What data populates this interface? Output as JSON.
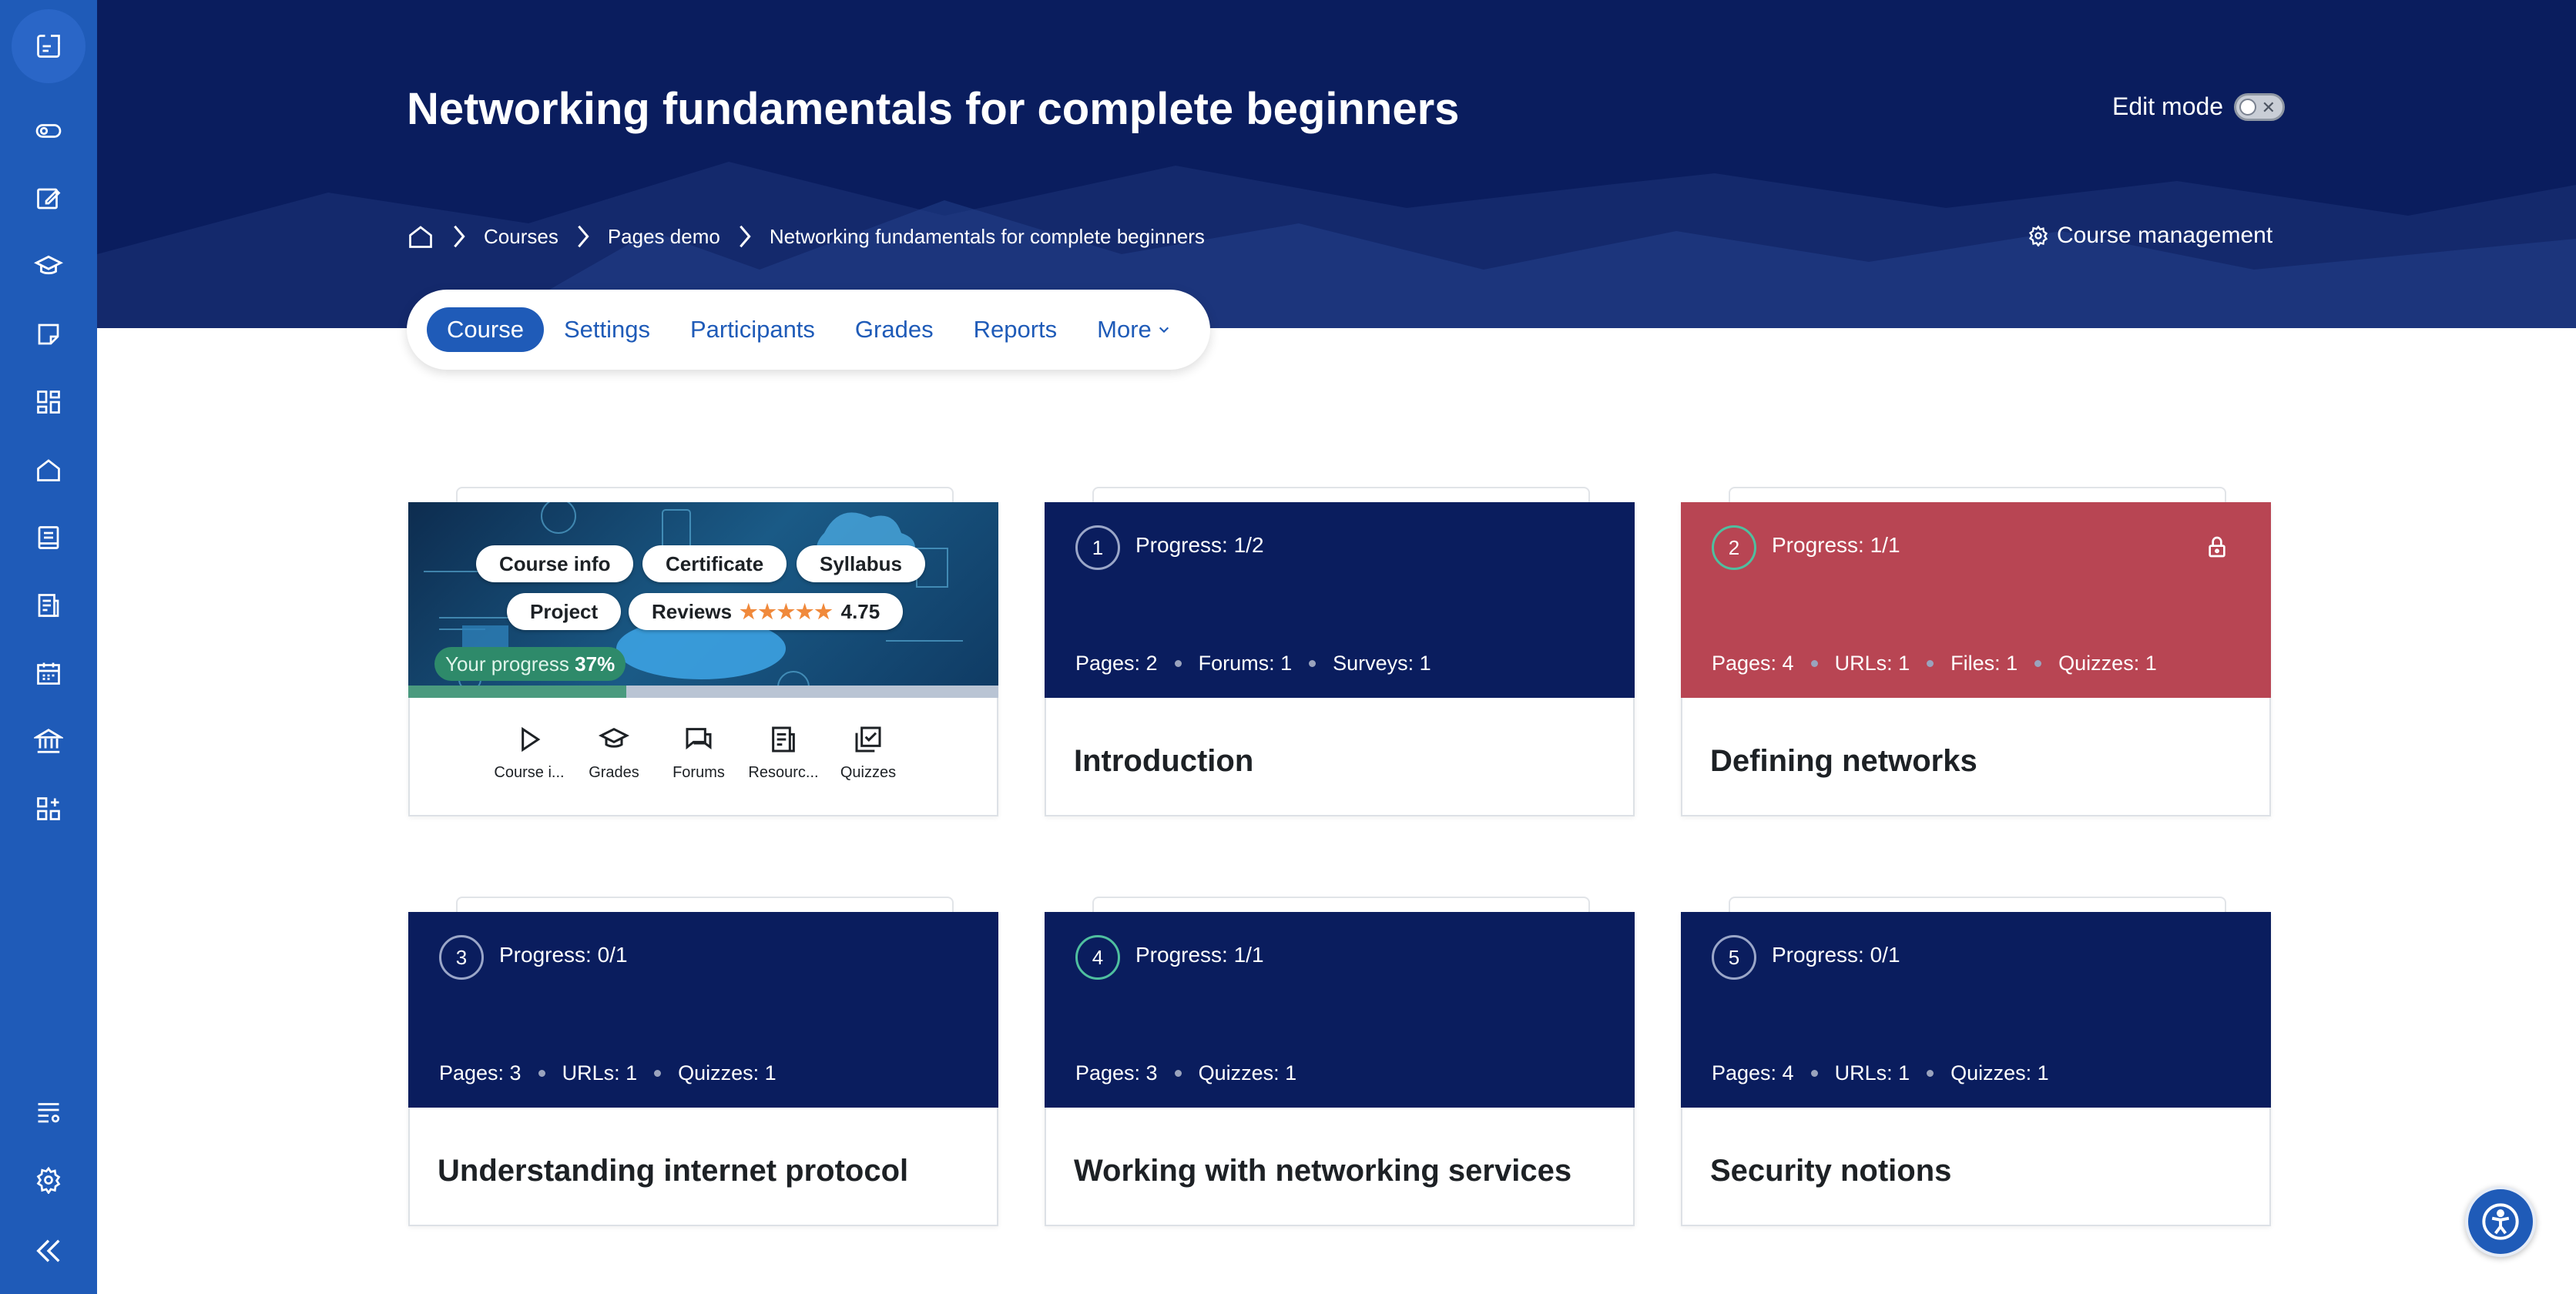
{
  "course": {
    "title": "Networking fundamentals for complete beginners"
  },
  "header": {
    "edit_mode_label": "Edit mode",
    "course_management_label": "Course management"
  },
  "breadcrumb": [
    "Courses",
    "Pages demo",
    "Networking fundamentals for complete beginners"
  ],
  "tabs": [
    "Course",
    "Settings",
    "Participants",
    "Grades",
    "Reports",
    "More"
  ],
  "sidebar": {
    "icons": [
      "collapse-panel-icon",
      "toggle-icon",
      "edit-icon",
      "graduation-cap-icon",
      "note-icon",
      "dashboard-icon",
      "home-icon",
      "book-icon",
      "report-icon",
      "calendar-icon",
      "institution-icon",
      "add-block-icon",
      "settings-list-icon",
      "gear-icon",
      "double-chevron-left-icon"
    ]
  },
  "course_info_card": {
    "buttons": {
      "course_info": "Course info",
      "certificate": "Certificate",
      "syllabus": "Syllabus",
      "project": "Project",
      "reviews": "Reviews"
    },
    "rating": "4.75",
    "progress_label": "Your progress",
    "progress_value": "37%",
    "progress_fraction": 0.37,
    "quick_links": [
      "Course i...",
      "Grades",
      "Forums",
      "Resourc...",
      "Quizzes"
    ]
  },
  "sections": [
    {
      "number": "1",
      "progress": "Progress: 1/2",
      "stats": [
        "Pages: 2",
        "Forums: 1",
        "Surveys: 1"
      ],
      "title": "Introduction"
    },
    {
      "number": "2",
      "progress": "Progress: 1/1",
      "stats": [
        "Pages: 4",
        "URLs: 1",
        "Files: 1",
        "Quizzes: 1"
      ],
      "title": "Defining networks"
    },
    {
      "number": "3",
      "progress": "Progress: 0/1",
      "stats": [
        "Pages: 3",
        "URLs: 1",
        "Quizzes: 1"
      ],
      "title": "Understanding internet protocol"
    },
    {
      "number": "4",
      "progress": "Progress: 1/1",
      "stats": [
        "Pages: 3",
        "Quizzes: 1"
      ],
      "title": "Working with networking services"
    },
    {
      "number": "5",
      "progress": "Progress: 0/1",
      "stats": [
        "Pages: 4",
        "URLs: 1",
        "Quizzes: 1"
      ],
      "title": "Security notions"
    }
  ],
  "colors": {
    "primary": "#1f5bb8",
    "header_bg": "#0a1d5e",
    "section_bg": "#0a1d5e",
    "locked_section_bg": "#b84553",
    "complete_ring": "#4fbf9f"
  }
}
